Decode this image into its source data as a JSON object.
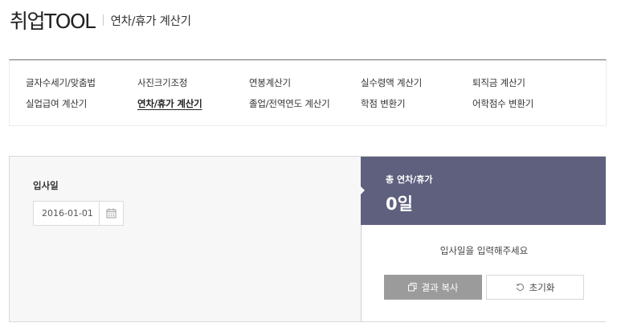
{
  "header": {
    "logo": "취업TOOL",
    "subtitle": "연차/휴가 계산기"
  },
  "nav": {
    "items": [
      {
        "label": "글자수세기/맞춤법"
      },
      {
        "label": "사진크기조정"
      },
      {
        "label": "연봉계산기"
      },
      {
        "label": "실수령액 계산기"
      },
      {
        "label": "퇴직금 계산기"
      },
      {
        "label": "실업급여 계산기"
      },
      {
        "label": "연차/휴가 계산기",
        "active": true
      },
      {
        "label": "졸업/전역연도 계산기"
      },
      {
        "label": "학점 변환기"
      },
      {
        "label": "어학점수 변환기"
      }
    ]
  },
  "calculator": {
    "input_label": "입사일",
    "date_value": "2016-01-01",
    "calendar_icon": "calendar-icon"
  },
  "result": {
    "label": "총 연차/휴가",
    "value": "0일",
    "message": "입사일을 입력해주세요",
    "copy_label": "결과 복사",
    "reset_label": "초기화",
    "colors": {
      "header_bg": "#5e607e",
      "copy_bg": "#9b9b9b"
    }
  }
}
